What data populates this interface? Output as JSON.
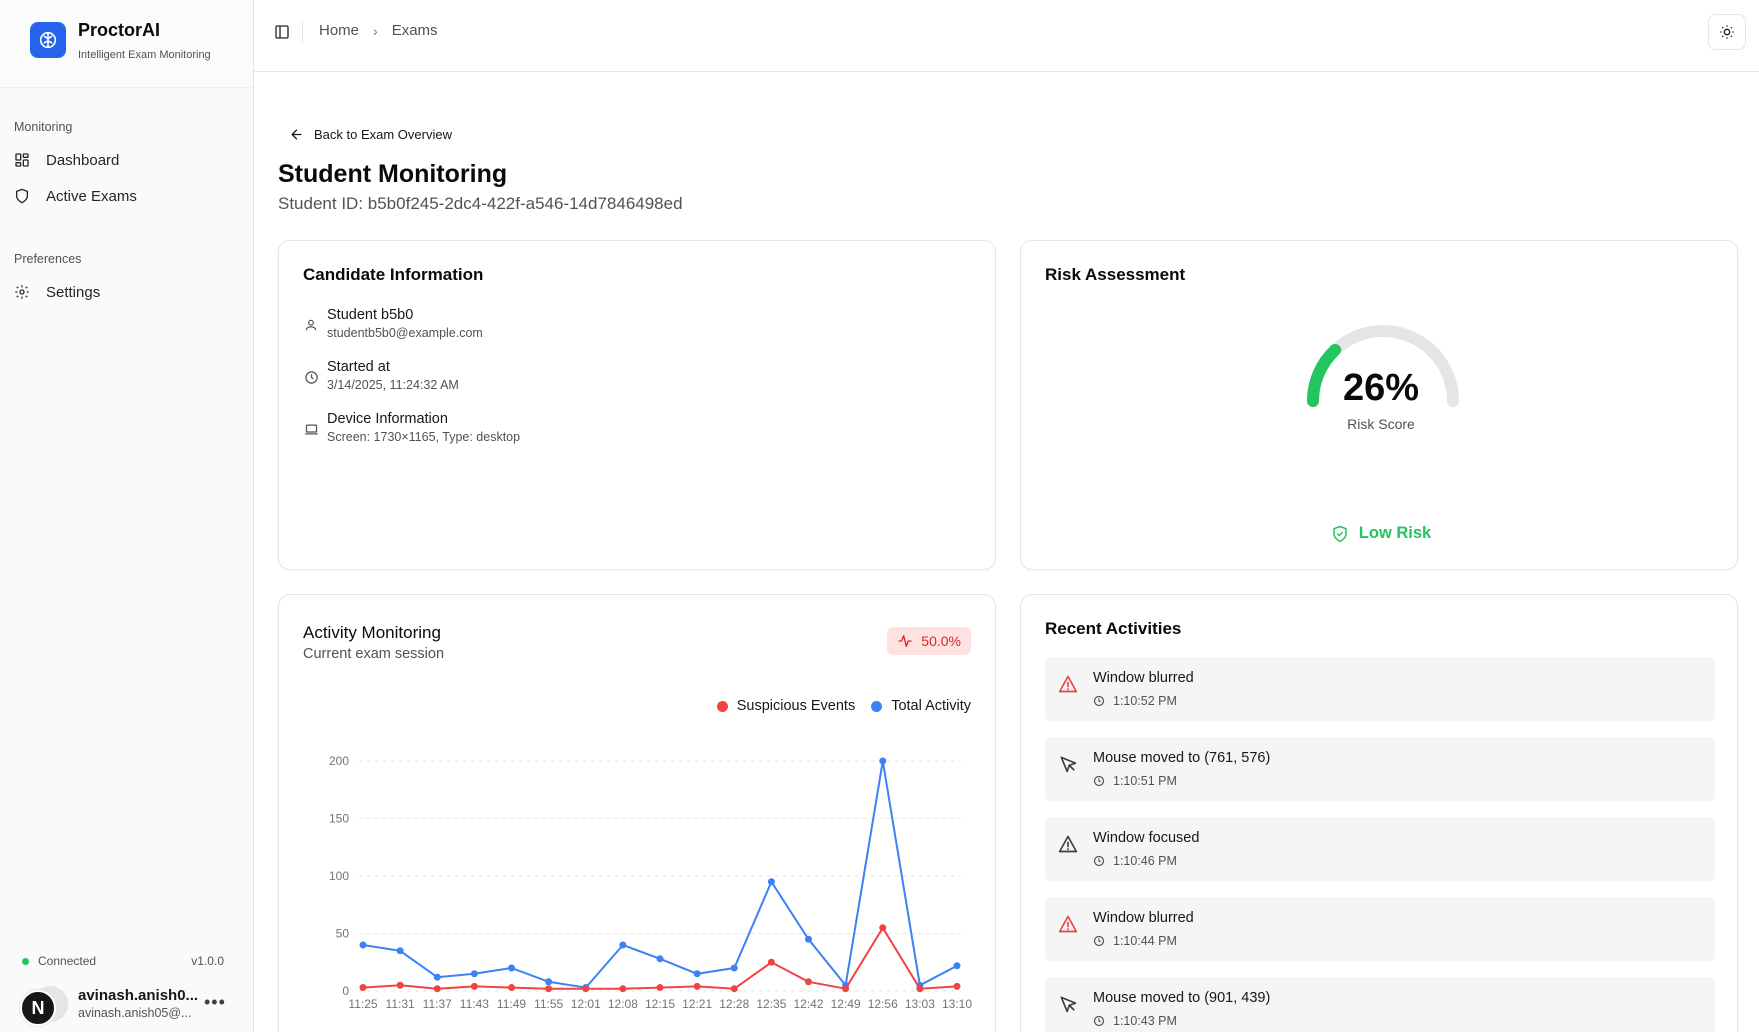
{
  "app": {
    "name": "ProctorAI",
    "tagline": "Intelligent Exam Monitoring",
    "accent": "#2563eb"
  },
  "sidebar": {
    "groups": [
      {
        "label": "Monitoring",
        "items": [
          {
            "label": "Dashboard",
            "icon": "grid-icon"
          },
          {
            "label": "Active Exams",
            "icon": "shield-icon"
          }
        ]
      },
      {
        "label": "Preferences",
        "items": [
          {
            "label": "Settings",
            "icon": "gear-icon"
          }
        ]
      }
    ],
    "status": "Connected",
    "version": "v1.0.0",
    "user": {
      "initial": "N",
      "name": "avinash.anish0...",
      "email": "avinash.anish05@..."
    }
  },
  "header": {
    "breadcrumb": [
      "Home",
      "Exams"
    ]
  },
  "page": {
    "back_label": "Back to Exam Overview",
    "title": "Student Monitoring",
    "student_id": "Student ID: b5b0f245-2dc4-422f-a546-14d7846498ed"
  },
  "candidate": {
    "title": "Candidate Information",
    "rows": [
      {
        "icon": "user-icon",
        "label": "Student b5b0",
        "value": "studentb5b0@example.com"
      },
      {
        "icon": "clock-icon",
        "label": "Started at",
        "value": "3/14/2025, 11:24:32 AM"
      },
      {
        "icon": "laptop-icon",
        "label": "Device Information",
        "value": "Screen: 1730×1165, Type: desktop"
      }
    ]
  },
  "risk": {
    "title": "Risk Assessment",
    "score": 26,
    "score_text": "26%",
    "score_label": "Risk Score",
    "level": "Low Risk",
    "level_color": "#22c55e"
  },
  "activity": {
    "title": "Activity Monitoring",
    "subtitle": "Current exam session",
    "badge": "50.0%",
    "chart_data": {
      "type": "line",
      "x": [
        "11:25",
        "11:31",
        "11:37",
        "11:43",
        "11:49",
        "11:55",
        "12:01",
        "12:08",
        "12:15",
        "12:21",
        "12:28",
        "12:35",
        "12:42",
        "12:49",
        "12:56",
        "13:03",
        "13:10"
      ],
      "ylim": [
        0,
        200
      ],
      "yticks": [
        0,
        50,
        100,
        150,
        200
      ],
      "grid": true,
      "legend_position": "top-right",
      "series": [
        {
          "name": "Suspicious Events",
          "color": "#ef4444",
          "values": [
            3,
            5,
            2,
            4,
            3,
            2,
            2,
            2,
            3,
            4,
            2,
            25,
            8,
            2,
            55,
            2,
            4
          ]
        },
        {
          "name": "Total Activity",
          "color": "#3b82f6",
          "values": [
            40,
            35,
            12,
            15,
            20,
            8,
            3,
            40,
            28,
            15,
            20,
            95,
            45,
            5,
            200,
            5,
            22
          ]
        }
      ]
    }
  },
  "recent": {
    "title": "Recent Activities",
    "items": [
      {
        "text": "Window blurred",
        "time": "1:10:52 PM",
        "icon": "alert-triangle-icon",
        "severity": "danger"
      },
      {
        "text": "Mouse moved to (761, 576)",
        "time": "1:10:51 PM",
        "icon": "cursor-icon",
        "severity": "normal"
      },
      {
        "text": "Window focused",
        "time": "1:10:46 PM",
        "icon": "alert-triangle-icon",
        "severity": "normal"
      },
      {
        "text": "Window blurred",
        "time": "1:10:44 PM",
        "icon": "alert-triangle-icon",
        "severity": "danger"
      },
      {
        "text": "Mouse moved to (901, 439)",
        "time": "1:10:43 PM",
        "icon": "cursor-icon",
        "severity": "normal"
      }
    ]
  }
}
